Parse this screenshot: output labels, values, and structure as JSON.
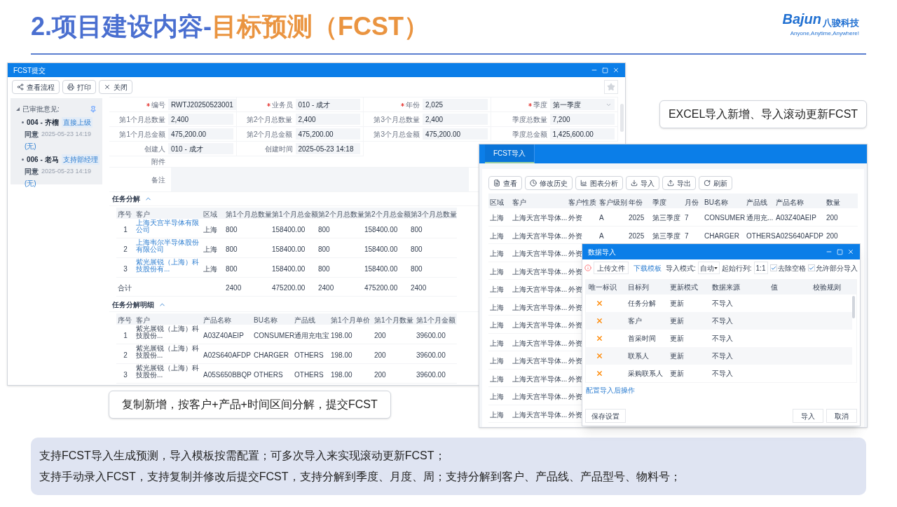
{
  "slide": {
    "title_prefix": "2.项目建设内容-",
    "title_highlight": "目标预测（FCST）",
    "logo": {
      "brand": "Bajun",
      "name": "八骏科技",
      "slogan": "Anyone,Anytime,Anywhere!"
    }
  },
  "submit_window": {
    "title": "FCST提交",
    "toolbar": [
      {
        "kind": "flow",
        "label": "查看流程"
      },
      {
        "kind": "print",
        "label": "打印"
      },
      {
        "kind": "close",
        "label": "关闭"
      }
    ],
    "approvals": {
      "heading": "已审批意见:",
      "expanded": true,
      "items": [
        {
          "user": "004 - 齐榴",
          "role": "直接上级",
          "result": "同意",
          "time": "2025-05-23 14:19",
          "comment": "(无)"
        },
        {
          "user": "006 - 老马",
          "role": "支持部经理",
          "result": "同意",
          "time": "2025-05-23 14:19",
          "comment": "(无)"
        }
      ]
    },
    "fields": [
      [
        {
          "label": "编号",
          "required": true,
          "value": "RWTJ20250523001"
        },
        {
          "label": "业务员",
          "required": true,
          "value": "010 - 成才"
        },
        {
          "label": "年份",
          "required": true,
          "value": "2,025"
        },
        {
          "label": "季度",
          "required": true,
          "value": "第一季度",
          "kind": "select"
        }
      ],
      [
        {
          "label": "第1个月总数量",
          "required": false,
          "value": "2,400"
        },
        {
          "label": "第2个月总数量",
          "required": false,
          "value": "2,400"
        },
        {
          "label": "第3个月总数量",
          "required": false,
          "value": "2,400"
        },
        {
          "label": "季度总数量",
          "required": false,
          "value": "7,200"
        }
      ],
      [
        {
          "label": "第1个月总金额",
          "required": false,
          "value": "475,200.00"
        },
        {
          "label": "第2个月总金额",
          "required": false,
          "value": "475,200.00"
        },
        {
          "label": "第3个月总金额",
          "required": false,
          "value": "475,200.00"
        },
        {
          "label": "季度总金额",
          "required": false,
          "value": "1,425,600.00"
        }
      ],
      [
        {
          "label": "创建人",
          "required": false,
          "value": "010 - 成才"
        },
        {
          "label": "创建时间",
          "required": false,
          "value": "2025-05-23 14:18"
        }
      ]
    ],
    "attachment_label": "附件",
    "remark_label": "备注",
    "sections": [
      {
        "title": "任务分解",
        "expanded": true,
        "columns": [
          "序号",
          "客户",
          "区域",
          "第1个月总数量",
          "第1个月总金额",
          "第2个月总数量",
          "第2个月总金额",
          "第3个月总数量"
        ],
        "rows": [
          {
            "kind": "item",
            "linked": true,
            "cells": [
              "1",
              "上海天宫半导体有限公司",
              "上海",
              "800",
              "158400.00",
              "800",
              "158400.00",
              "800"
            ]
          },
          {
            "kind": "item",
            "linked": true,
            "cells": [
              "2",
              "上海韦尔半导体股份有限公司",
              "上海",
              "800",
              "158400.00",
              "800",
              "158400.00",
              "800"
            ]
          },
          {
            "kind": "item",
            "linked": true,
            "cells": [
              "3",
              "紫光展锐（上海）科技股份有...",
              "上海",
              "800",
              "158400.00",
              "800",
              "158400.00",
              "800"
            ]
          },
          {
            "kind": "total",
            "label": "合计",
            "values": [
              "2400",
              "475200.00",
              "2400",
              "475200.00",
              "2400"
            ]
          }
        ]
      },
      {
        "title": "任务分解明细",
        "expanded": true,
        "columns": [
          "序号",
          "客户",
          "产品名称",
          "BU名称",
          "产品线",
          "第1个月单价",
          "第1个月数量",
          "第1个月金额"
        ],
        "rows": [
          {
            "kind": "item",
            "cells": [
              "1",
              "紫光展锐（上海）科技股份...",
              "A03Z40AEIP",
              "CONSUMER",
              "通用充电宝",
              "198.00",
              "200",
              "39600.00"
            ]
          },
          {
            "kind": "item",
            "cells": [
              "2",
              "紫光展锐（上海）科技股份...",
              "A02S640AFDP",
              "CHARGER",
              "OTHERS",
              "198.00",
              "200",
              "39600.00"
            ]
          },
          {
            "kind": "item",
            "cells": [
              "3",
              "紫光展锐（上海）科技股份...",
              "A05S650BBQP",
              "OTHERS",
              "OTHERS",
              "198.00",
              "200",
              "39600.00"
            ]
          }
        ]
      }
    ]
  },
  "import_window": {
    "tabs": [
      {
        "label": "FCST导入",
        "selected": true
      }
    ],
    "toolbar": [
      {
        "kind": "view",
        "label": "查看"
      },
      {
        "kind": "history",
        "label": "修改历史"
      },
      {
        "kind": "chart",
        "label": "图表分析"
      },
      {
        "kind": "import",
        "label": "导入"
      },
      {
        "kind": "export",
        "label": "导出"
      },
      {
        "kind": "refresh",
        "label": "刷新"
      }
    ],
    "columns": [
      "区域",
      "客户",
      "客户性质",
      "客户级别",
      "年份",
      "季度",
      "月份",
      "BU名称",
      "产品线",
      "产品名称",
      "数量"
    ],
    "rows": [
      [
        "上海",
        "上海天宫半导体...",
        "外资",
        "A",
        "2025",
        "第三季度",
        "7",
        "CONSUMER",
        "通用充...",
        "A03Z40AEIP",
        "200"
      ],
      [
        "上海",
        "上海天宫半导体...",
        "外资",
        "A",
        "2025",
        "第三季度",
        "7",
        "CHARGER",
        "OTHERS",
        "A02S640AFDP",
        "200"
      ],
      [
        "上海",
        "上海天宫半导体...",
        "外资"
      ],
      [
        "上海",
        "上海天宫半导体...",
        "外资"
      ],
      [
        "上海",
        "上海天宫半导体...",
        "外资"
      ],
      [
        "上海",
        "上海天宫半导体...",
        "外资"
      ],
      [
        "上海",
        "上海天宫半导体...",
        "外资"
      ],
      [
        "上海",
        "上海天宫半导体...",
        "外资"
      ],
      [
        "上海",
        "上海天宫半导体...",
        "外资"
      ],
      [
        "上海",
        "上海天宫半导体...",
        "外资"
      ],
      [
        "上海",
        "上海天宫半导体...",
        "外资"
      ],
      [
        "上海",
        "上海天宫半导体...",
        "外资"
      ]
    ]
  },
  "import_dialog": {
    "title": "数据导入",
    "upload_button": "上传文件",
    "template_link": "下载模板",
    "mode_label": "导入模式:",
    "mode_value": "自动",
    "start_label": "起始行列:",
    "start_value": "1:1",
    "options": [
      {
        "label": "去除空格",
        "checked": true
      },
      {
        "label": "允许部分导入",
        "checked": true
      }
    ],
    "columns": [
      "唯一标识",
      "目标列",
      "更新模式",
      "数据来源",
      "值",
      "校验规则"
    ],
    "rows": [
      {
        "unique": false,
        "column": "任务分解",
        "mode": "更新",
        "source": "不导入"
      },
      {
        "unique": false,
        "column": "客户",
        "mode": "更新",
        "source": "不导入"
      },
      {
        "unique": false,
        "column": "首采时间",
        "mode": "更新",
        "source": "不导入"
      },
      {
        "unique": false,
        "column": "联系人",
        "mode": "更新",
        "source": "不导入"
      },
      {
        "unique": false,
        "column": "采购联系人",
        "mode": "更新",
        "source": "不导入"
      }
    ],
    "after_link": "配置导入后操作",
    "save_button": "保存设置",
    "buttons": [
      "导入",
      "取消"
    ]
  },
  "callouts": [
    "EXCEL导入新增、导入滚动更新FCST",
    "复制新增，按客户+产品+时间区间分解，提交FCST"
  ],
  "notes": [
    "支持FCST导入生成预测，导入模板按需配置；可多次导入来实现滚动更新FCST；",
    "支持手动录入FCST，支持复制并修改后提交FCST，支持分解到季度、月度、周；支持分解到客户、产品线、产品型号、物料号；"
  ]
}
